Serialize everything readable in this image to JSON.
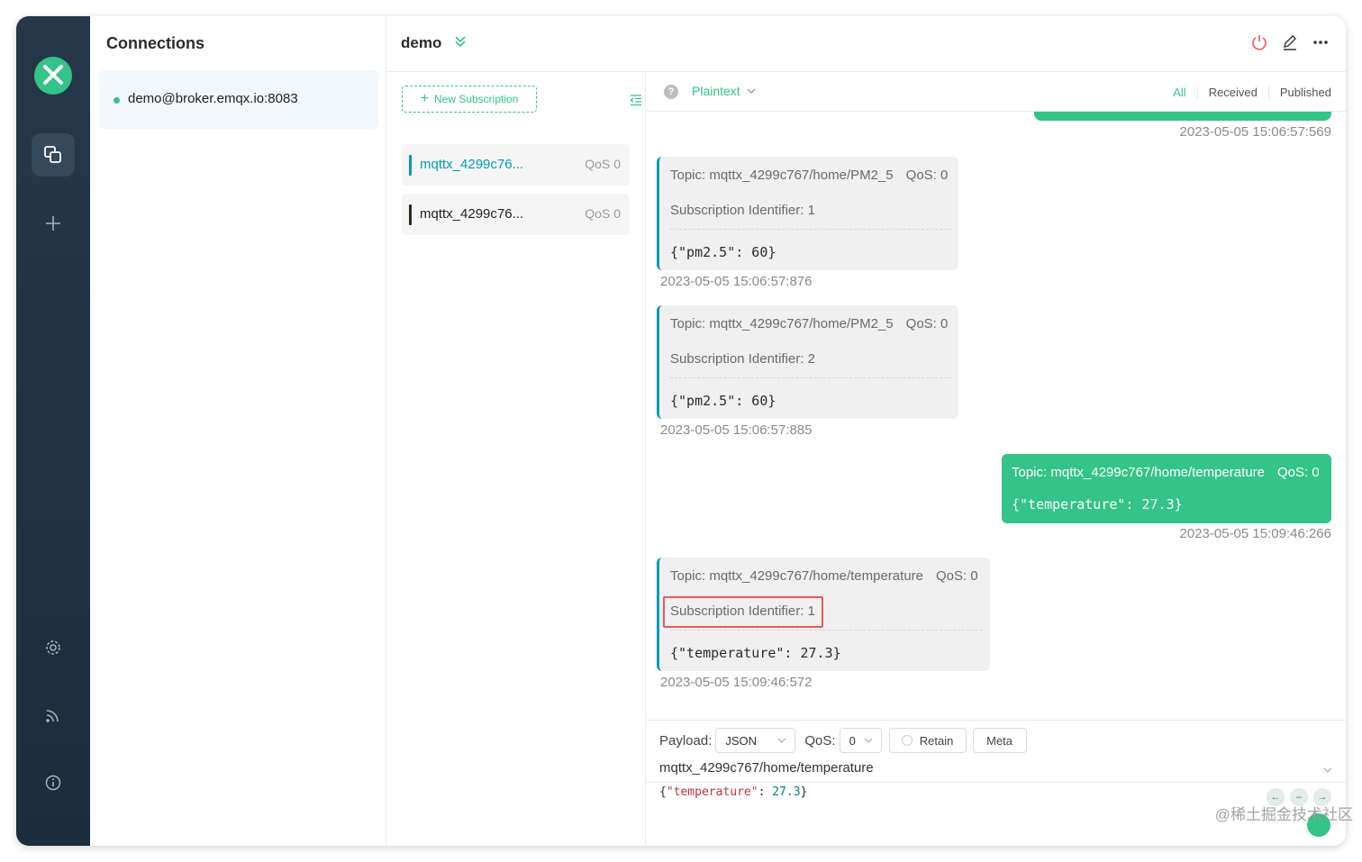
{
  "colors": {
    "accent": "#34c388",
    "incoming_bar": "#009cb6",
    "highlight": "#e85a5a",
    "rail": "#25384a"
  },
  "connections": {
    "title": "Connections",
    "items": [
      {
        "label": "demo@broker.emqx.io:8083",
        "status": "connected"
      }
    ]
  },
  "header": {
    "title": "demo"
  },
  "subscriptions": {
    "new_button": "New Subscription",
    "items": [
      {
        "topic": "mqttx_4299c76...",
        "qos": "QoS 0",
        "color": "#009cb6"
      },
      {
        "topic": "mqttx_4299c76...",
        "qos": "QoS 0",
        "color": "#2b2b1b"
      }
    ]
  },
  "toolbar": {
    "format": "Plaintext",
    "filters": [
      "All",
      "Received",
      "Published"
    ]
  },
  "messages": [
    {
      "direction": "out",
      "timestamp": "2023-05-05 15:06:57:569"
    },
    {
      "direction": "in",
      "topic": "Topic: mqttx_4299c767/home/PM2_5",
      "qos": "QoS: 0",
      "sub_id": "Subscription Identifier: 1",
      "payload": "{\"pm2.5\": 60}",
      "timestamp": "2023-05-05 15:06:57:876"
    },
    {
      "direction": "in",
      "topic": "Topic: mqttx_4299c767/home/PM2_5",
      "qos": "QoS: 0",
      "sub_id": "Subscription Identifier: 2",
      "payload": "{\"pm2.5\": 60}",
      "timestamp": "2023-05-05 15:06:57:885"
    },
    {
      "direction": "out",
      "topic": "Topic: mqttx_4299c767/home/temperature",
      "qos": "QoS: 0",
      "payload": "{\"temperature\": 27.3}",
      "timestamp": "2023-05-05 15:09:46:266"
    },
    {
      "direction": "in",
      "topic": "Topic: mqttx_4299c767/home/temperature",
      "qos": "QoS: 0",
      "sub_id": "Subscription Identifier: 1",
      "payload": "{\"temperature\": 27.3}",
      "timestamp": "2023-05-05 15:09:46:572"
    }
  ],
  "publish": {
    "payload_label": "Payload:",
    "payload_format": "JSON",
    "qos_label": "QoS:",
    "qos_value": "0",
    "retain_label": "Retain",
    "meta_label": "Meta",
    "topic": "mqttx_4299c767/home/temperature",
    "payload_key": "\"temperature\"",
    "payload_value": "27.3"
  },
  "watermark": "@稀土掘金技术社区"
}
